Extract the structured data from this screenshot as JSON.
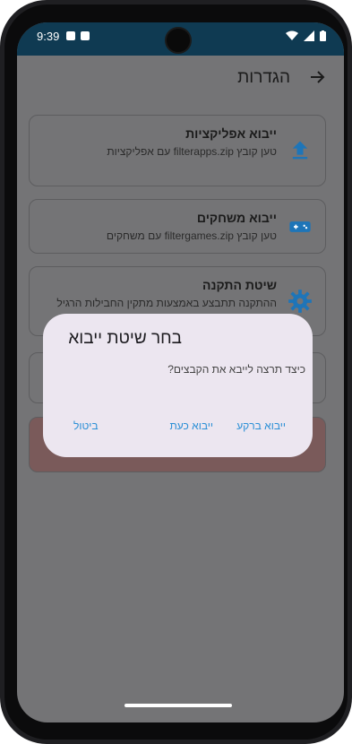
{
  "status": {
    "time": "9:39"
  },
  "appbar": {
    "title": "הגדרות",
    "back_icon": "arrow-back-icon"
  },
  "cards": [
    {
      "title": "ייבוא אפליקציות",
      "subtitle": "טען קובץ filterapps.zip עם אפליקציות",
      "icon": "upload-icon"
    },
    {
      "title": "ייבוא משחקים",
      "subtitle": "טען קובץ filtergames.zip עם משחקים",
      "icon": "gamepad-icon"
    },
    {
      "title": "שיטת התקנה",
      "subtitle": "ההתקנה תתבצע באמצעות מתקין החבילות הרגיל",
      "icon": "gear-icon"
    }
  ],
  "dialog": {
    "title": "בחר שיטת ייבוא",
    "text": "כיצד תרצה לייבא את הקבצים?",
    "buttons": {
      "background": "ייבוא ברקע",
      "now": "ייבוא כעת",
      "cancel": "ביטול"
    }
  },
  "colors": {
    "accent": "#2a8fd6",
    "statusbar": "#0f3a52",
    "dialog": "#ece6f0",
    "danger_card": "#7a5a5a"
  }
}
